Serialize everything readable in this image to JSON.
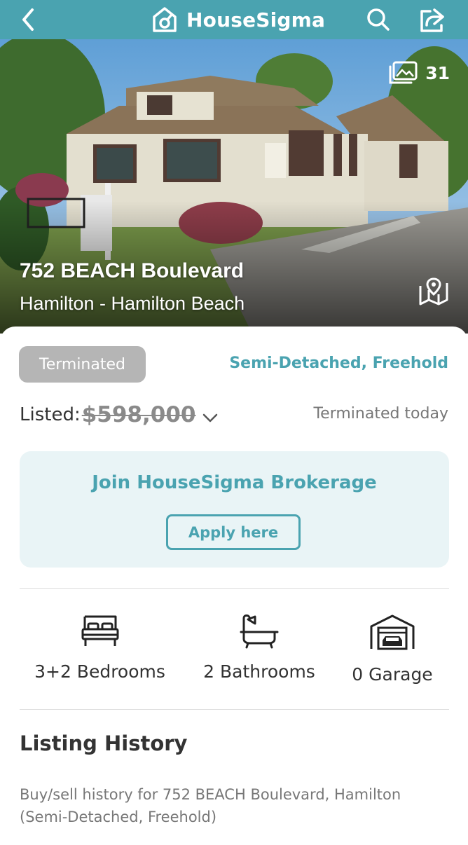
{
  "header": {
    "brand": "HouseSigma",
    "back_icon": "back-arrow-icon",
    "search_icon": "search-icon",
    "share_icon": "share-icon",
    "color": "#4aa3b0"
  },
  "hero": {
    "photo_count": "31",
    "address": "752 BEACH Boulevard",
    "location": "Hamilton - Hamilton Beach",
    "map_icon": "map-icon"
  },
  "listing": {
    "status": "Terminated",
    "property_type": "Semi-Detached, Freehold",
    "listed_label": "Listed:",
    "listed_price": "$598,000",
    "terminated_when": "Terminated today"
  },
  "promo": {
    "title": "Join HouseSigma Brokerage",
    "button": "Apply here"
  },
  "features": [
    {
      "icon": "bed-icon",
      "label": "3+2 Bedrooms"
    },
    {
      "icon": "bathtub-icon",
      "label": "2 Bathrooms"
    },
    {
      "icon": "garage-icon",
      "label": "0 Garage"
    }
  ],
  "history": {
    "title": "Listing History",
    "description": "Buy/sell history for 752 BEACH Boulevard, Hamilton (Semi-Detached, Freehold)"
  }
}
